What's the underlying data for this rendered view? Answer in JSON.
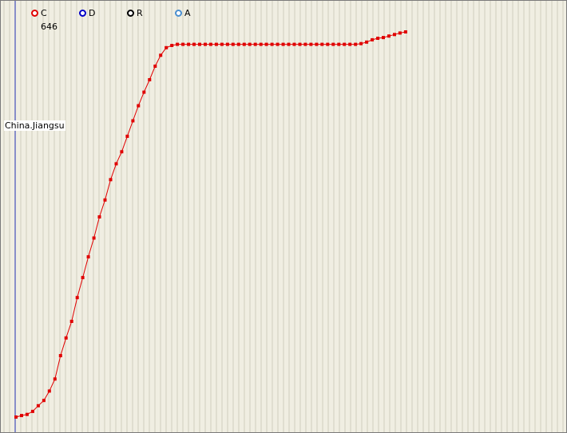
{
  "legend": [
    {
      "label": "C",
      "color": "#e00000"
    },
    {
      "label": "D",
      "color": "#0000c8"
    },
    {
      "label": "R",
      "color": "#000000"
    },
    {
      "label": "A",
      "color": "#4a8fd0"
    }
  ],
  "readout": "646",
  "region_label": "China.Jiangsu",
  "chart_data": {
    "type": "line",
    "title": "",
    "xlabel": "",
    "ylabel": "",
    "ylim": [
      0,
      660
    ],
    "series": [
      {
        "name": "C",
        "color": "#e00000",
        "values": [
          1,
          5,
          8,
          16,
          31,
          45,
          70,
          102,
          164,
          211,
          255,
          318,
          371,
          426,
          476,
          532,
          577,
          631,
          673,
          705,
          746,
          787,
          827,
          863,
          896,
          932,
          961,
          981,
          987,
          990,
          990,
          990,
          990,
          990,
          990,
          990,
          990,
          990,
          990,
          990,
          990,
          990,
          990,
          990,
          990,
          990,
          990,
          990,
          990,
          990,
          990,
          990,
          990,
          990,
          990,
          990,
          990,
          990,
          990,
          990,
          990,
          990,
          992,
          996,
          1002,
          1006,
          1008,
          1012,
          1016,
          1020,
          1023
        ]
      }
    ]
  }
}
